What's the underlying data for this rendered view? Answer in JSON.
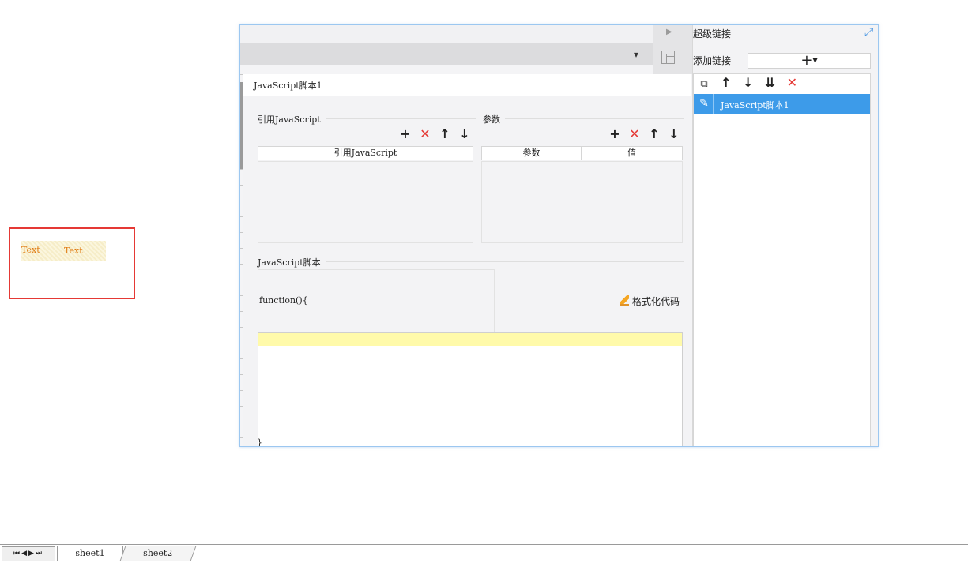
{
  "canvas": {
    "cells": [
      {
        "text": "Text"
      },
      {
        "text": "Text"
      }
    ]
  },
  "dialog": {
    "toolbar": {
      "icon": "dropdown-arrow-icon"
    },
    "strip": {
      "expand_icon": "triangle-right-icon",
      "grid_icon": "table-icon"
    },
    "pane": {
      "title": "JavaScript脚本1",
      "ref_section": {
        "label": "引用JavaScript",
        "column_header": "引用JavaScript"
      },
      "param_section": {
        "label": "参数",
        "columns": [
          "参数",
          "值"
        ]
      },
      "script_section": {
        "label": "JavaScript脚本",
        "function_header": "function(){",
        "closing": "}",
        "format_button": "格式化代码"
      },
      "tools": {
        "add": "+",
        "delete": "✕",
        "up": "↑",
        "down": "↓"
      }
    },
    "hyperlink": {
      "title": "超级链接",
      "add_label": "添加链接",
      "add_button": "+",
      "items": [
        {
          "label": "JavaScript脚本1"
        }
      ]
    }
  },
  "sheets": {
    "nav": "⏮◀▶⏭",
    "tabs": [
      "sheet1",
      "sheet2"
    ]
  },
  "colors": {
    "accent": "#3d9be9",
    "danger": "#e53935",
    "code_highlight": "#fffaaa"
  }
}
